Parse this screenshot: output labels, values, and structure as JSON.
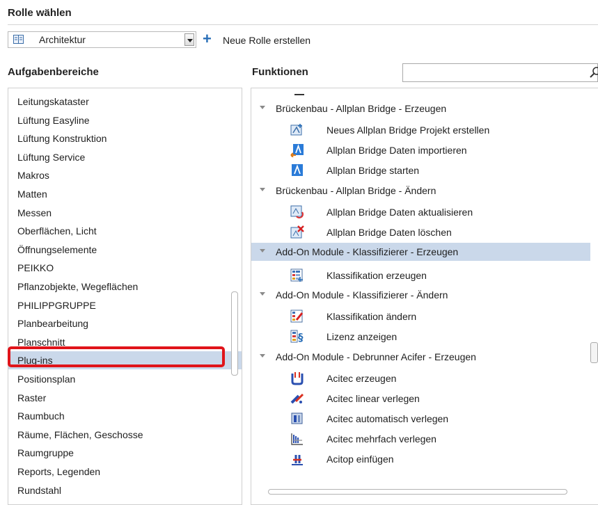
{
  "header": {
    "title": "Rolle wählen"
  },
  "role_select": {
    "value": "Architektur",
    "icon": "book-icon"
  },
  "new_role": {
    "label": "Neue Rolle erstellen",
    "icon": "plus-icon"
  },
  "left": {
    "heading": "Aufgabenbereiche",
    "items": [
      "Leitungskataster",
      "Lüftung Easyline",
      "Lüftung Konstruktion",
      "Lüftung Service",
      "Makros",
      "Matten",
      "Messen",
      "Oberflächen, Licht",
      "Öffnungselemente",
      "PEIKKO",
      "Pflanzobjekte, Wegeflächen",
      "PHILIPPGRUPPE",
      "Planbearbeitung",
      "Planschnitt",
      "Plug-ins",
      "Positionsplan",
      "Raster",
      "Raumbuch",
      "Räume, Flächen, Geschosse",
      "Raumgruppe",
      "Reports, Legenden",
      "Rundstahl"
    ],
    "selected": "Plug-ins"
  },
  "right": {
    "heading": "Funktionen",
    "search": {
      "value": "",
      "icon": "search-icon"
    },
    "groups": [
      {
        "label": "Brückenbau - Allplan Bridge - Erzeugen",
        "selected": false,
        "items": [
          {
            "label": "Neues Allplan Bridge Projekt erstellen",
            "icon": "new-project-icon"
          },
          {
            "label": "Allplan Bridge Daten importieren",
            "icon": "bridge-import-icon"
          },
          {
            "label": "Allplan Bridge starten",
            "icon": "bridge-start-icon"
          }
        ]
      },
      {
        "label": "Brückenbau - Allplan Bridge - Ändern",
        "selected": false,
        "items": [
          {
            "label": "Allplan Bridge Daten aktualisieren",
            "icon": "bridge-refresh-icon"
          },
          {
            "label": "Allplan Bridge Daten löschen",
            "icon": "bridge-delete-icon"
          }
        ]
      },
      {
        "label": "Add-On Module - Klassifizierer - Erzeugen",
        "selected": true,
        "items": [
          {
            "label": "Klassifikation erzeugen",
            "icon": "classification-create-icon"
          }
        ]
      },
      {
        "label": "Add-On Module - Klassifizierer - Ändern",
        "selected": false,
        "items": [
          {
            "label": "Klassifikation ändern",
            "icon": "classification-edit-icon"
          },
          {
            "label": "Lizenz anzeigen",
            "icon": "license-icon"
          }
        ]
      },
      {
        "label": "Add-On Module - Debrunner Acifer - Erzeugen",
        "selected": false,
        "items": [
          {
            "label": "Acitec erzeugen",
            "icon": "acitec-create-icon"
          },
          {
            "label": "Acitec linear verlegen",
            "icon": "acitec-linear-icon"
          },
          {
            "label": "Acitec automatisch verlegen",
            "icon": "acitec-auto-icon"
          },
          {
            "label": "Acitec mehrfach verlegen",
            "icon": "acitec-multiple-icon"
          },
          {
            "label": "Acitop einfügen",
            "icon": "acitop-insert-icon"
          }
        ]
      }
    ]
  },
  "colors": {
    "selection": "#cad8ea",
    "highlight_box": "#e0141a",
    "accent": "#2a6fb8"
  }
}
